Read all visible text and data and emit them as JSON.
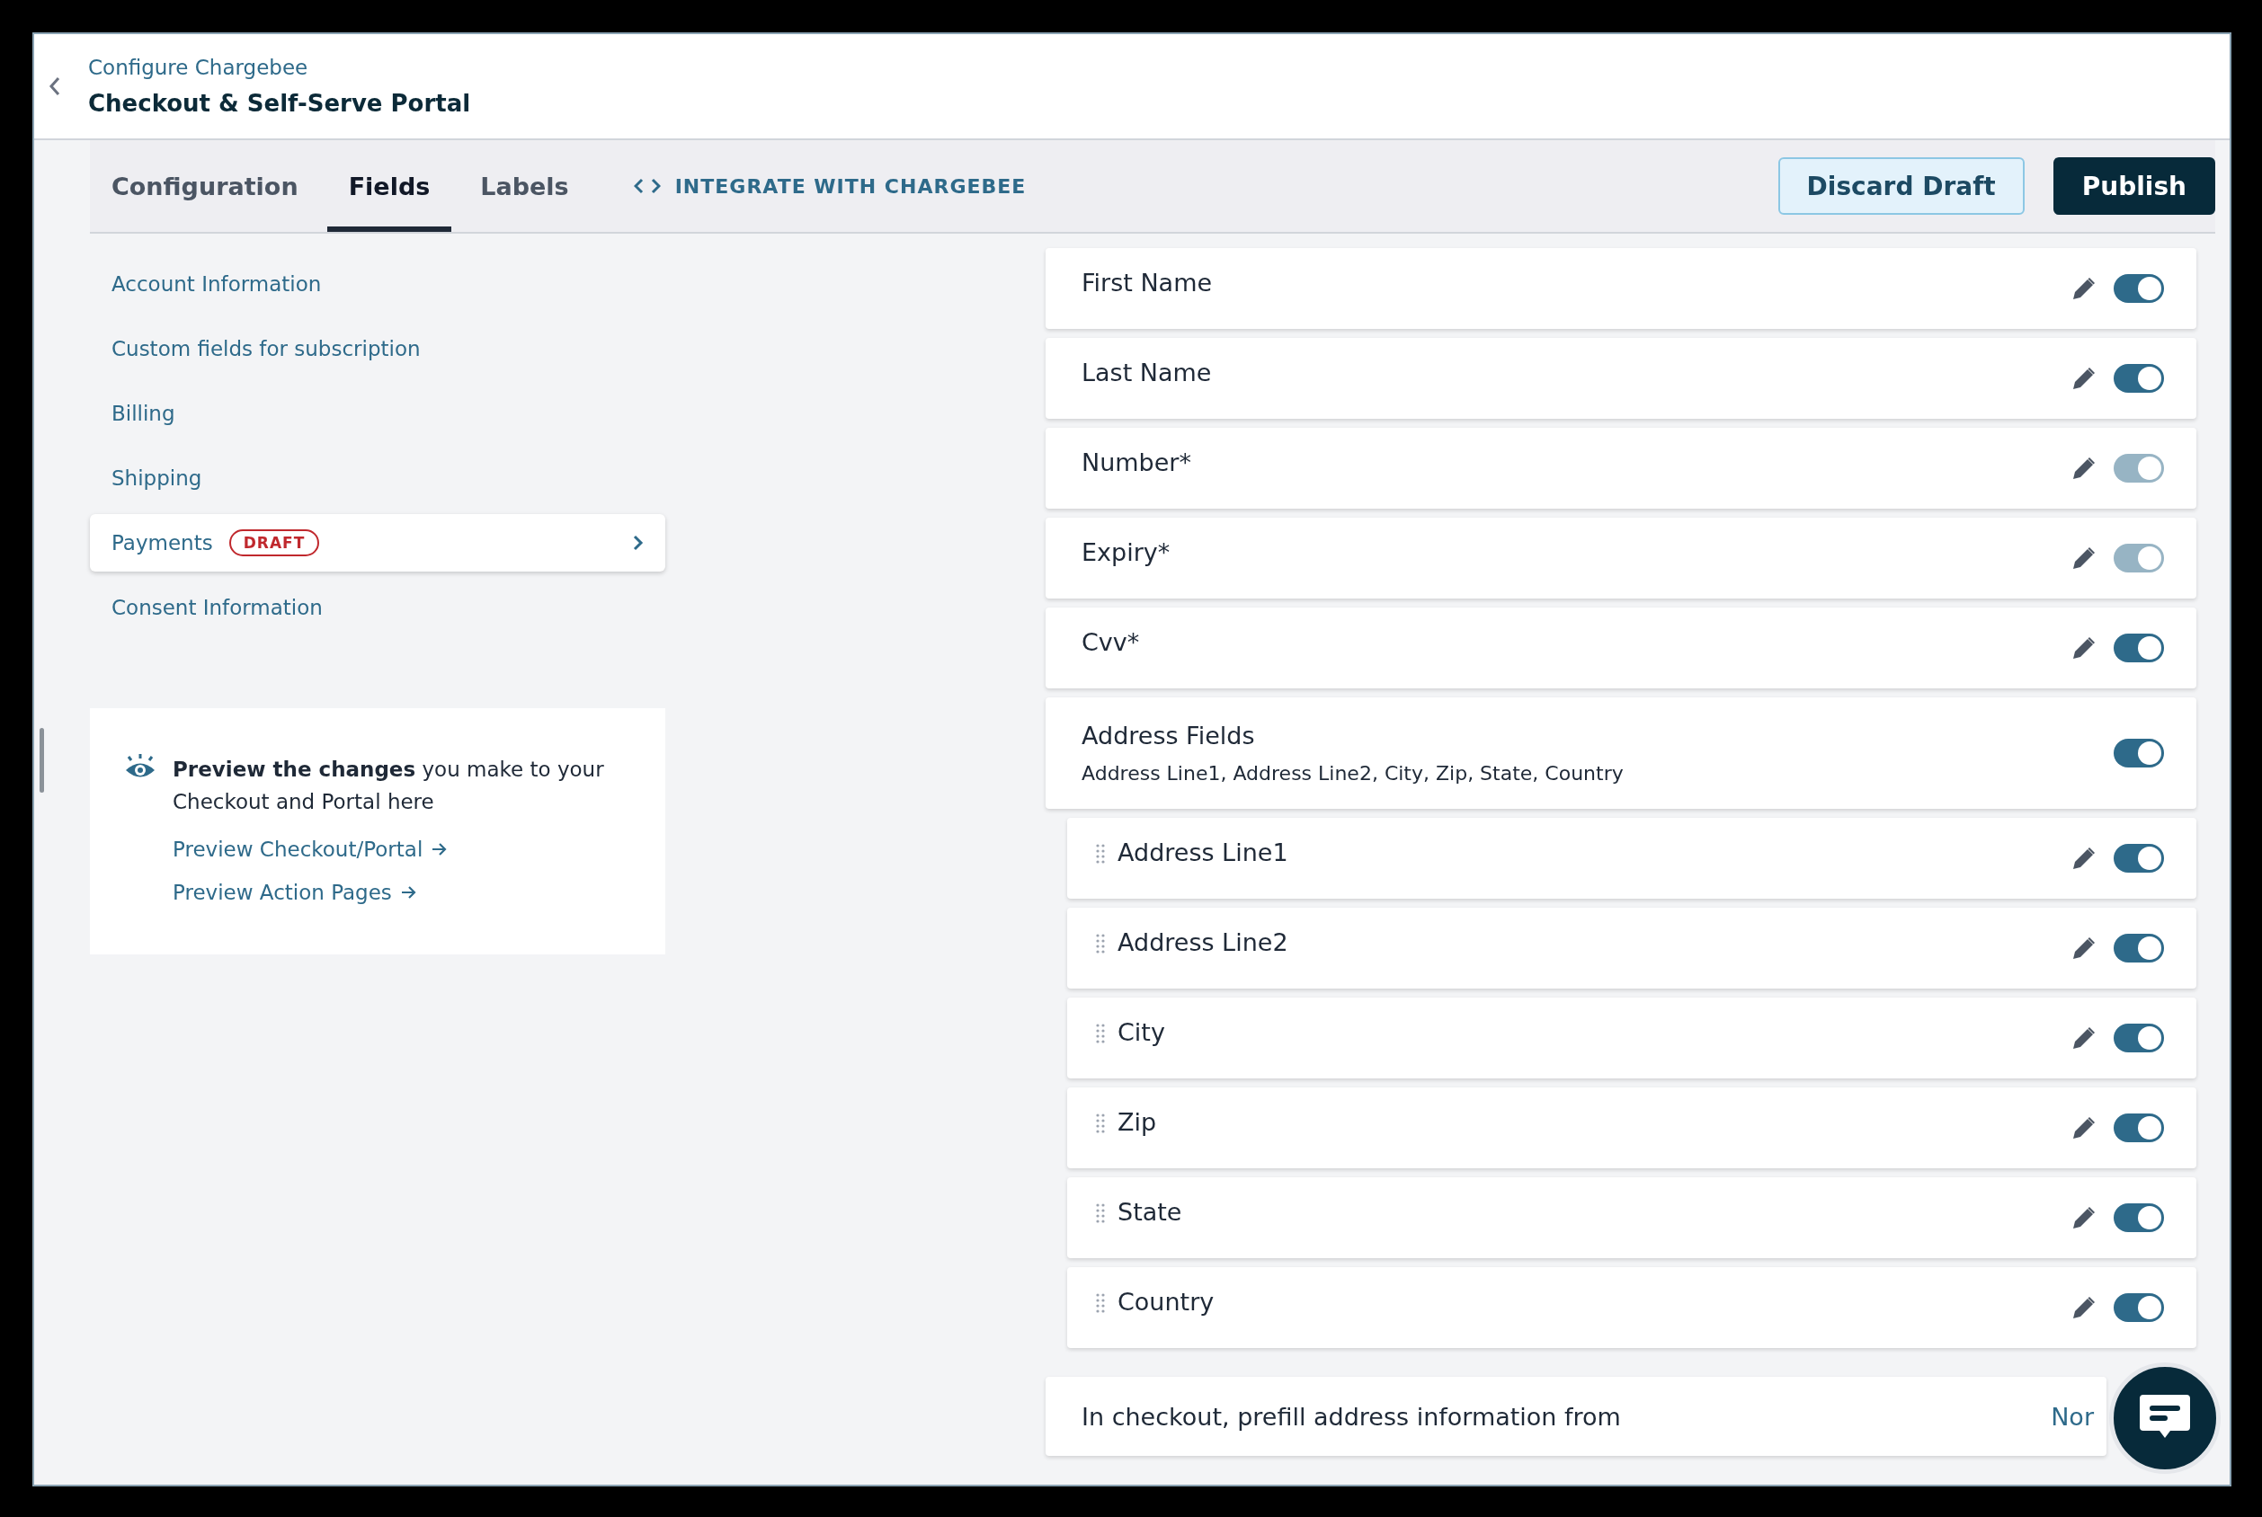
{
  "header": {
    "breadcrumb": "Configure Chargebee",
    "title": "Checkout & Self-Serve Portal"
  },
  "tabs": [
    {
      "label": "Configuration",
      "selected": false
    },
    {
      "label": "Fields",
      "selected": true
    },
    {
      "label": "Labels",
      "selected": false
    }
  ],
  "integrate_link": "INTEGRATE WITH CHARGEBEE",
  "actions": [
    {
      "label": "Discard Draft",
      "kind": "secondary"
    },
    {
      "label": "Publish",
      "kind": "primary"
    }
  ],
  "sidebar": {
    "items": [
      {
        "label": "Account Information",
        "selected": false
      },
      {
        "label": "Custom fields for subscription",
        "selected": false
      },
      {
        "label": "Billing",
        "selected": false
      },
      {
        "label": "Shipping",
        "selected": false
      },
      {
        "label": "Payments",
        "selected": true,
        "badge": "DRAFT"
      },
      {
        "label": "Consent Information",
        "selected": false
      }
    ]
  },
  "preview_card": {
    "text": "**Preview the changes** you make to your Checkout and Portal here",
    "links": [
      "Preview Checkout/Portal",
      "Preview Action Pages"
    ]
  },
  "fields": [
    {
      "kind": "field",
      "label": "First Name",
      "on": true,
      "disabled": false
    },
    {
      "kind": "field",
      "label": "Last Name",
      "on": true,
      "disabled": false
    },
    {
      "kind": "field",
      "label": "Number*",
      "on": true,
      "disabled": true
    },
    {
      "kind": "field",
      "label": "Expiry*",
      "on": true,
      "disabled": true
    },
    {
      "kind": "field",
      "label": "Cvv*",
      "on": true,
      "disabled": false
    },
    {
      "kind": "group",
      "label": "Address Fields",
      "summary": "Address Line1, Address Line2, City, Zip, State, Country",
      "on": true,
      "disabled": false,
      "children": [
        {
          "kind": "field",
          "label": "Address Line1",
          "on": true,
          "disabled": false
        },
        {
          "kind": "field",
          "label": "Address Line2",
          "on": true,
          "disabled": false
        },
        {
          "kind": "field",
          "label": "City",
          "on": true,
          "disabled": false
        },
        {
          "kind": "field",
          "label": "Zip",
          "on": true,
          "disabled": false
        },
        {
          "kind": "field",
          "label": "State",
          "on": true,
          "disabled": false
        },
        {
          "kind": "field",
          "label": "Country",
          "on": true,
          "disabled": false
        }
      ]
    },
    {
      "kind": "setting",
      "label": "In checkout, prefill address information from",
      "value": "Nor"
    }
  ]
}
